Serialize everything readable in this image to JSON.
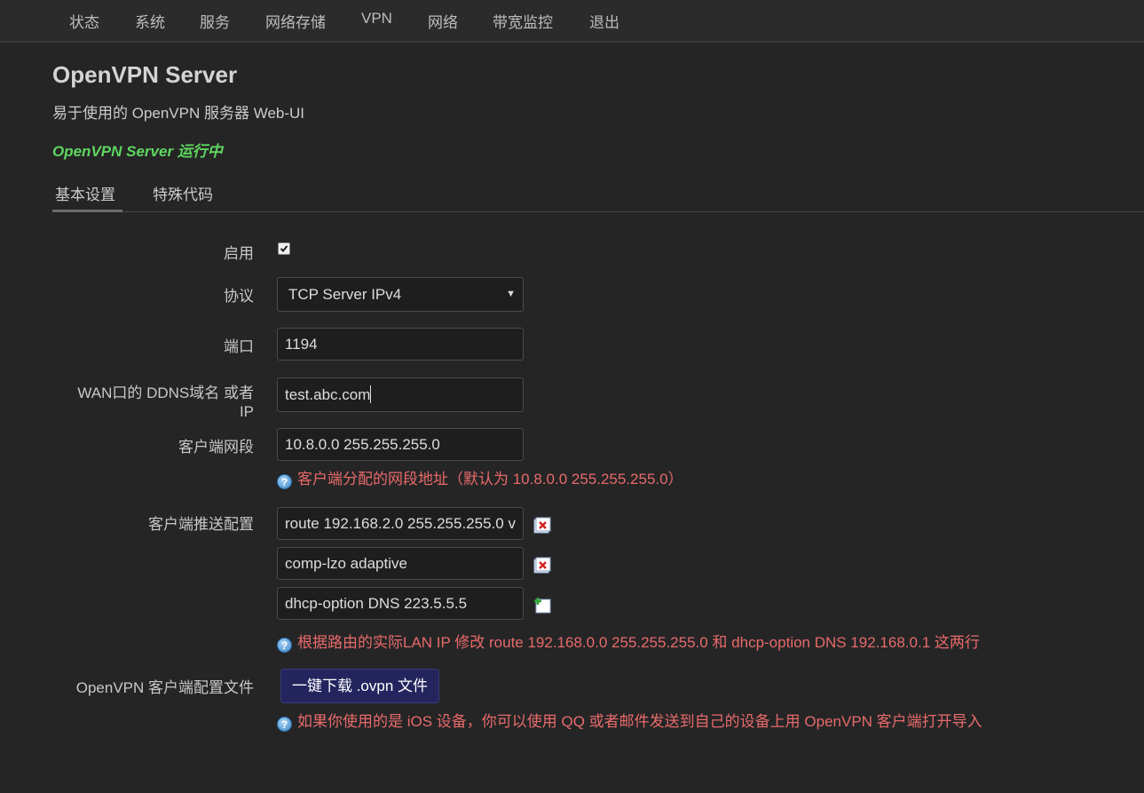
{
  "nav": {
    "items": [
      "状态",
      "系统",
      "服务",
      "网络存储",
      "VPN",
      "网络",
      "带宽监控",
      "退出"
    ]
  },
  "page": {
    "title": "OpenVPN Server",
    "description": "易于使用的 OpenVPN 服务器 Web-UI",
    "status": "OpenVPN Server 运行中"
  },
  "tabs": [
    "基本设置",
    "特殊代码"
  ],
  "form": {
    "enable_label": "启用",
    "enabled": true,
    "protocol_label": "协议",
    "protocol_value": "TCP Server IPv4",
    "port_label": "端口",
    "port_value": "1194",
    "ddns_label_line1": "WAN口的 DDNS域名 或者",
    "ddns_label_line2": "IP",
    "ddns_value": "test.abc.com",
    "subnet_label": "客户端网段",
    "subnet_value": "10.8.0.0 255.255.255.0",
    "subnet_hint": "客户端分配的网段地址（默认为 10.8.0.0 255.255.255.0）",
    "push_label": "客户端推送配置",
    "push_values": [
      "route 192.168.2.0 255.255.255.0 v",
      "comp-lzo adaptive",
      "dhcp-option DNS 223.5.5.5"
    ],
    "push_hint": "根据路由的实际LAN IP 修改 route 192.168.0.0 255.255.255.0 和 dhcp-option DNS 192.168.0.1 这两行",
    "ovpn_label": "OpenVPN 客户端配置文件",
    "download_button": "一键下载 .ovpn 文件",
    "ovpn_hint": "如果你使用的是 iOS 设备，你可以使用 QQ 或者邮件发送到自己的设备上用 OpenVPN 客户端打开导入"
  },
  "icons": {
    "help": "help-icon",
    "remove": "remove-icon",
    "add": "add-icon",
    "dropdown": "chevron-down-icon"
  },
  "colors": {
    "status_green": "#5fd65f",
    "hint_red": "#e86a6a",
    "button_bg": "#24245e"
  }
}
